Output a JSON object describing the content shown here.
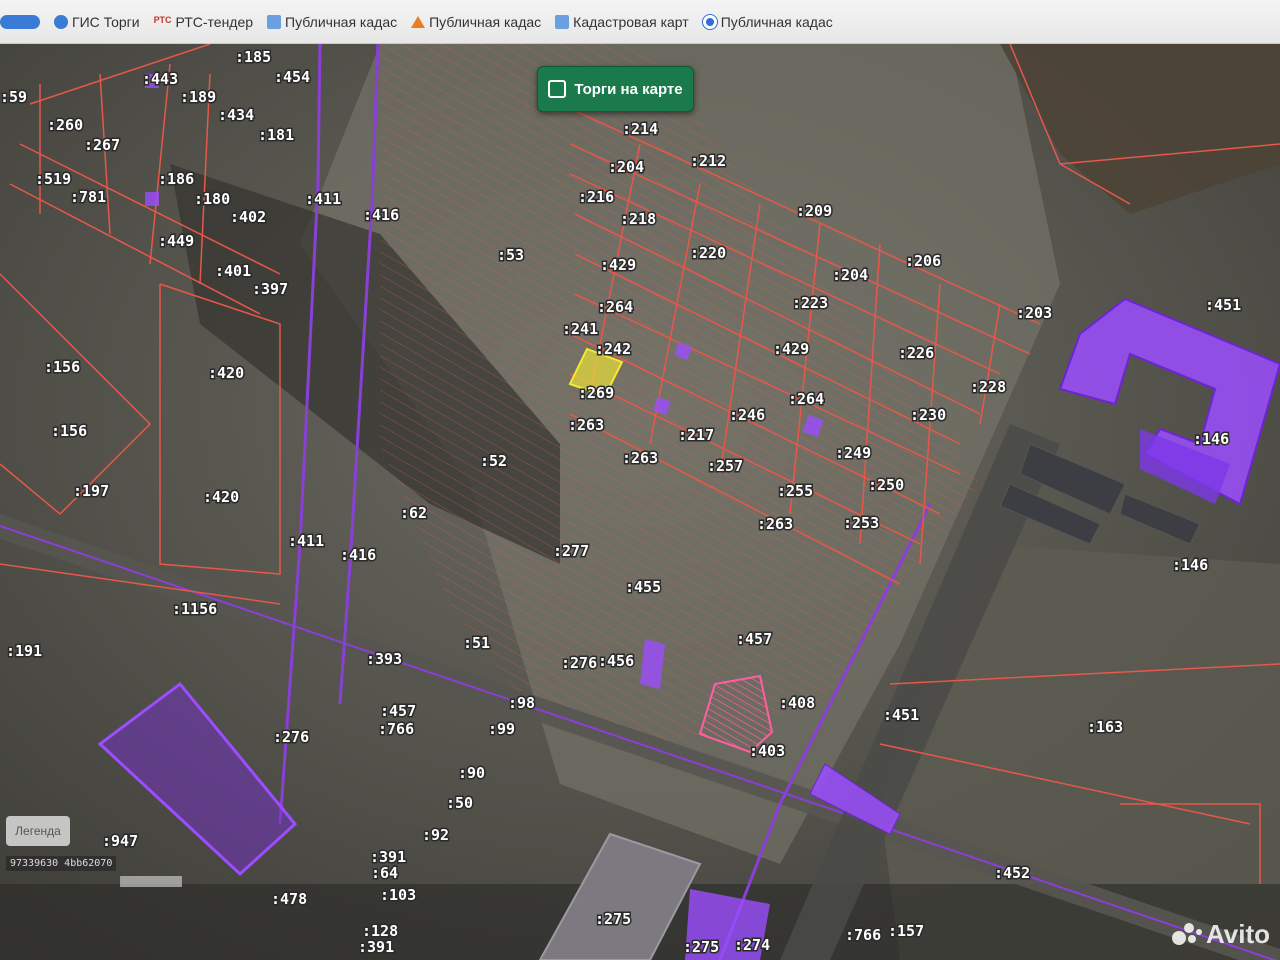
{
  "bookmarks": {
    "items": [
      {
        "label": "ГИС Торги",
        "icon": "gis-torgi-icon"
      },
      {
        "label": "РТС-тендер",
        "icon": "rts-tender-icon"
      },
      {
        "label": "Публичная кадас",
        "icon": "cadastre-arrow-icon"
      },
      {
        "label": "Публичная кадас",
        "icon": "cadastre-house-icon"
      },
      {
        "label": "Кадастровая карт",
        "icon": "cadastre-map-icon"
      },
      {
        "label": "Публичная кадас",
        "icon": "cadastre-circle-icon"
      }
    ]
  },
  "map": {
    "toggle_label": "Торги на карте",
    "legend_label": "Легенда",
    "coords_text": "97339630  4bb62070",
    "watermark": "Avito",
    "colors": {
      "parcel_border": "#e8574a",
      "highlight_parcel": "#e8e03a",
      "building_fill": "#9b4dff",
      "road": "#8a3fd6"
    },
    "parcel_labels": [
      ":185",
      ":454",
      ":443",
      ":189",
      ":434",
      ":181",
      ":260",
      ":267",
      ":519",
      ":186",
      ":781",
      ":180",
      ":402",
      ":449",
      ":401",
      ":397",
      ":411",
      ":416",
      ":214",
      ":204",
      ":212",
      ":216",
      ":218",
      ":209",
      ":53",
      ":220",
      ":429",
      ":204",
      ":206",
      ":264",
      ":223",
      ":203",
      ":451",
      ":241",
      ":242",
      ":429",
      ":226",
      ":269",
      ":264",
      ":228",
      ":263",
      ":217",
      ":246",
      ":230",
      ":146",
      ":263",
      ":257",
      ":249",
      ":250",
      ":52",
      ":255",
      ":253",
      ":263",
      ":62",
      ":277",
      ":411",
      ":416",
      ":146",
      ":455",
      ":1156",
      ":156",
      ":156",
      ":420",
      ":420",
      ":197",
      ":191",
      ":51",
      ":393",
      ":276",
      ":456",
      ":457",
      ":98",
      ":408",
      ":451",
      ":457",
      ":766",
      ":99",
      ":163",
      ":276",
      ":403",
      ":90",
      ":50",
      ":947",
      ":92",
      ":391",
      ":64",
      ":103",
      ":478",
      ":452",
      ":128",
      ":391",
      ":275",
      ":275",
      ":274",
      ":766",
      ":157",
      ":59"
    ]
  }
}
